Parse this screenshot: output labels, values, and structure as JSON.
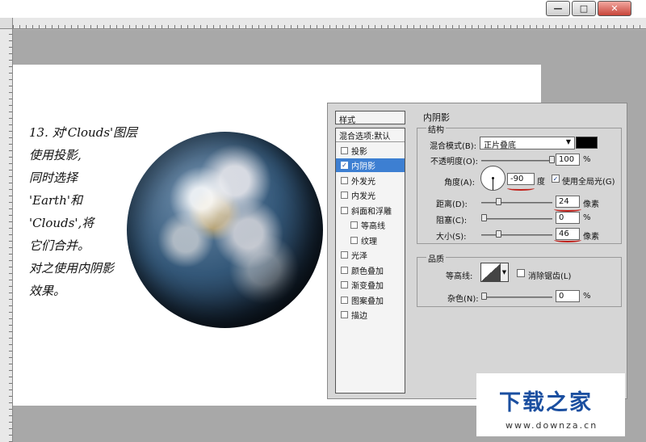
{
  "window": {
    "minimize_icon": "minimize-icon",
    "maximize_icon": "maximize-icon",
    "close_icon": "close-icon"
  },
  "note": {
    "lines": [
      "13. 对'Clouds'图层",
      "使用投影,",
      "同时选择",
      "'Earth'和",
      "'Clouds',将",
      "它们合并。",
      "对之使用内阴影",
      "效果。"
    ]
  },
  "styles_panel": {
    "header": "样式",
    "default_item": "混合选项:默认",
    "items": [
      {
        "label": "投影",
        "checked": false
      },
      {
        "label": "内阴影",
        "checked": true,
        "selected": true
      },
      {
        "label": "外发光",
        "checked": false
      },
      {
        "label": "内发光",
        "checked": false
      },
      {
        "label": "斜面和浮雕",
        "checked": false
      },
      {
        "label": "等高线",
        "checked": false,
        "sub": true
      },
      {
        "label": "纹理",
        "checked": false,
        "sub": true
      },
      {
        "label": "光泽",
        "checked": false
      },
      {
        "label": "颜色叠加",
        "checked": false
      },
      {
        "label": "渐变叠加",
        "checked": false
      },
      {
        "label": "图案叠加",
        "checked": false
      },
      {
        "label": "描边",
        "checked": false
      }
    ]
  },
  "inner_shadow": {
    "title": "内阴影",
    "structure": {
      "label": "结构",
      "blend_mode_label": "混合模式(B):",
      "blend_mode_value": "正片叠底",
      "shadow_color": "#000000",
      "opacity_label": "不透明度(O):",
      "opacity_value": "100",
      "opacity_unit": "%",
      "angle_label": "角度(A):",
      "angle_value": "-90",
      "angle_unit": "度",
      "global_light_label": "使用全局光(G)",
      "global_light_checked": true,
      "distance_label": "距离(D):",
      "distance_value": "24",
      "distance_unit": "像素",
      "choke_label": "阻塞(C):",
      "choke_value": "0",
      "choke_unit": "%",
      "size_label": "大小(S):",
      "size_value": "46",
      "size_unit": "像素"
    },
    "quality": {
      "label": "品质",
      "contour_label": "等高线:",
      "antialias_label": "消除锯齿(L)",
      "antialias_checked": false,
      "noise_label": "杂色(N):",
      "noise_value": "0",
      "noise_unit": "%"
    }
  },
  "watermark": {
    "text": "下载之家",
    "url": "www.downza.cn"
  }
}
